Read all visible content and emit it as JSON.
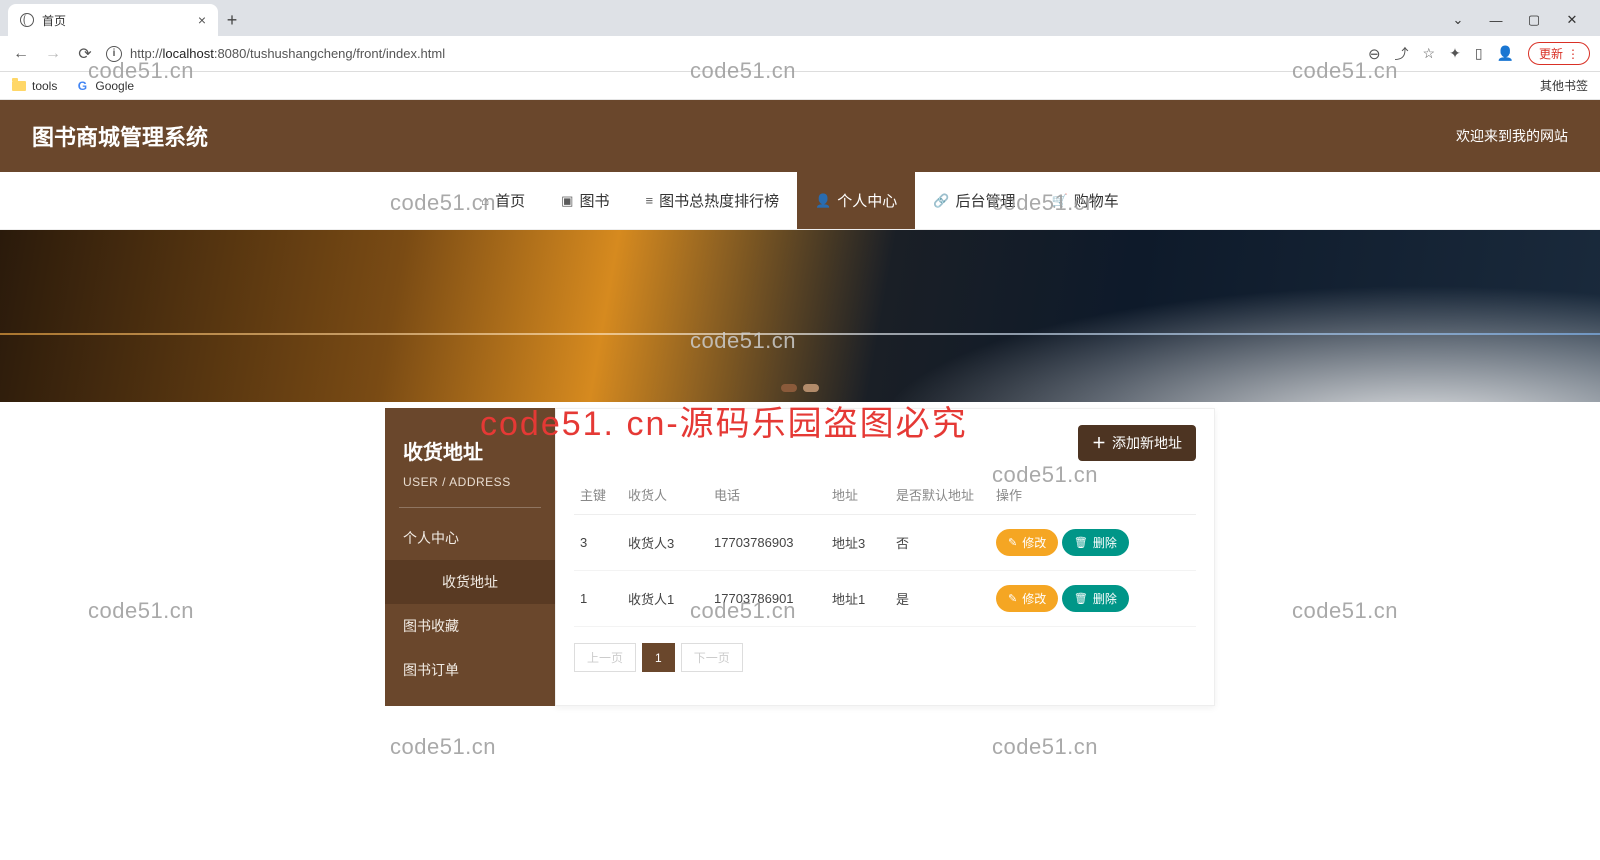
{
  "browser": {
    "tab_title": "首页",
    "url_prefix": "http://",
    "url_host": "localhost",
    "url_rest": ":8080/tushushangcheng/front/index.html",
    "update_label": "更新",
    "bookmarks": {
      "tools": "tools",
      "google": "Google",
      "other": "其他书签"
    },
    "win": {
      "min": "—",
      "max": "▢",
      "close": "✕",
      "expand": "⌄"
    }
  },
  "header": {
    "brand": "图书商城管理系统",
    "welcome": "欢迎来到我的网站"
  },
  "nav": {
    "items": [
      {
        "label": "首页",
        "ico": "⌂"
      },
      {
        "label": "图书",
        "ico": "▣"
      },
      {
        "label": "图书总热度排行榜",
        "ico": "≡"
      },
      {
        "label": "个人中心",
        "ico": "👤"
      },
      {
        "label": "后台管理",
        "ico": "🔗"
      },
      {
        "label": "购物车",
        "ico": "🛒"
      }
    ]
  },
  "sidebar": {
    "title": "收货地址",
    "subtitle": "USER / ADDRESS",
    "items": [
      {
        "label": "个人中心"
      },
      {
        "label": "收货地址",
        "active": true
      },
      {
        "label": "图书收藏"
      },
      {
        "label": "图书订单"
      }
    ]
  },
  "panel": {
    "add_label": "添加新地址",
    "columns": {
      "id": "主键",
      "name": "收货人",
      "phone": "电话",
      "addr": "地址",
      "def": "是否默认地址",
      "ops": "操作"
    },
    "edit_label": "修改",
    "del_label": "删除",
    "rows": [
      {
        "id": "3",
        "name": "收货人3",
        "phone": "17703786903",
        "addr": "地址3",
        "def": "否"
      },
      {
        "id": "1",
        "name": "收货人1",
        "phone": "17703786901",
        "addr": "地址1",
        "def": "是"
      }
    ],
    "pager": {
      "prev": "上一页",
      "page": "1",
      "next": "下一页"
    }
  },
  "watermark": {
    "grey": "code51.cn",
    "red": "code51. cn-源码乐园盗图必究"
  }
}
